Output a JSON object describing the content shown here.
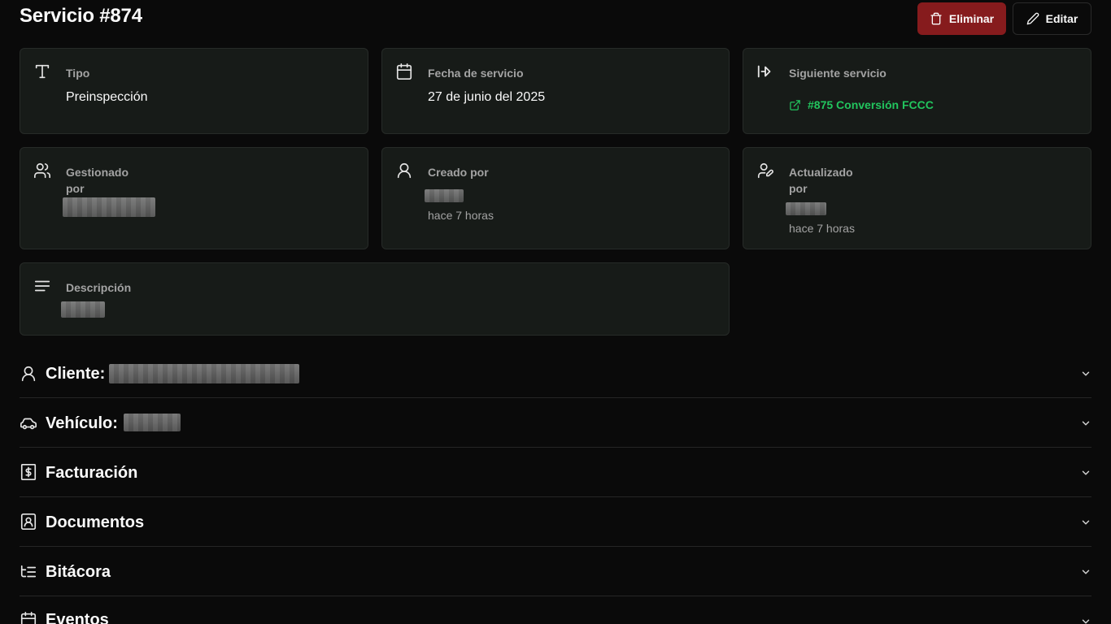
{
  "page": {
    "title": "Servicio #874"
  },
  "actions": {
    "delete_label": "Eliminar",
    "edit_label": "Editar"
  },
  "cards": {
    "tipo": {
      "label": "Tipo",
      "value": "Preinspección",
      "icon": "type-icon"
    },
    "fecha": {
      "label": "Fecha de servicio",
      "value": "27 de junio del 2025",
      "icon": "calendar-icon"
    },
    "siguiente": {
      "label": "Siguiente servicio",
      "link": "#875 Conversión FCCC",
      "icon": "arrow-right-to-line-icon"
    },
    "gestionado": {
      "label_line1": "Gestionado",
      "label_line2": "por",
      "icon": "users-icon"
    },
    "creado": {
      "label": "Creado por",
      "time": "hace 7 horas",
      "icon": "user-icon"
    },
    "actualizado": {
      "label_line1": "Actualizado",
      "label_line2": "por",
      "time": "hace 7 horas",
      "icon": "user-pen-icon"
    },
    "descripcion": {
      "label": "Descripción",
      "icon": "align-left-icon"
    }
  },
  "sections": [
    {
      "title": "Cliente:",
      "icon": "user-icon"
    },
    {
      "title": "Vehículo:",
      "icon": "car-icon"
    },
    {
      "title": "Facturación",
      "icon": "receipt-icon"
    },
    {
      "title": "Documentos",
      "icon": "contact-book-icon"
    },
    {
      "title": "Bitácora",
      "icon": "list-tree-icon"
    },
    {
      "title": "Eventos",
      "icon": "calendar-icon"
    }
  ],
  "colors": {
    "background": "#0a0a0a",
    "card": "#171b18",
    "danger": "#861b1d",
    "link": "#22c55e"
  }
}
